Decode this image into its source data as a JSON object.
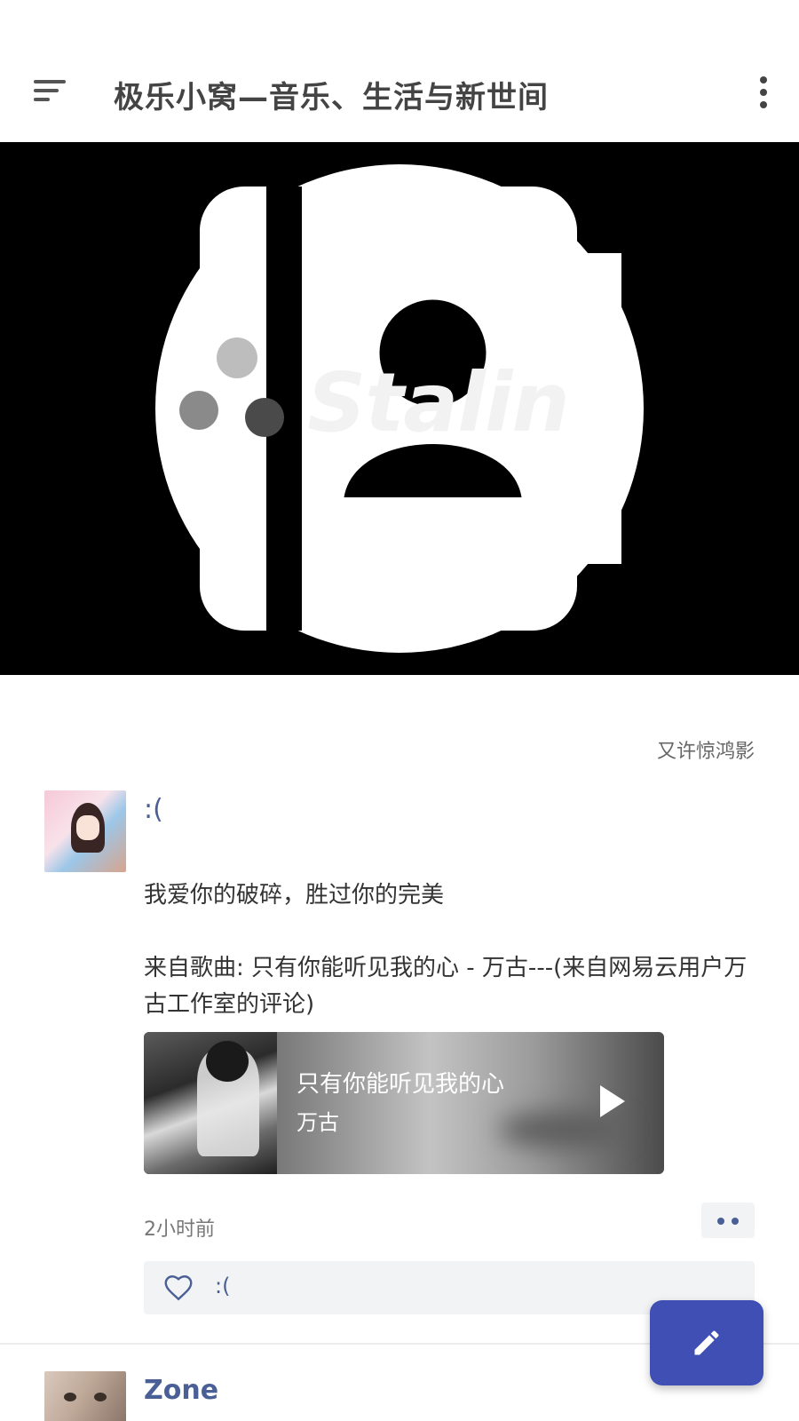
{
  "appbar": {
    "title": "极乐小窝—音乐、生活与新世间",
    "menu_icon": "sort-menu-icon",
    "more_icon": "more-vert-icon"
  },
  "hero": {
    "account_icon": "account-circle-icon",
    "contacts_icon": "contacts-book-icon",
    "logo_text": "Stalin"
  },
  "signature": "又许惊鸿影",
  "post": {
    "username": ":(",
    "text_line1": "我爱你的破碎，胜过你的完美",
    "text_line2": "来自歌曲: 只有你能听见我的心 - 万古---(来自网易云用户万古工作室的评论)",
    "music": {
      "song": "只有你能听见我的心",
      "artist": "万古"
    },
    "time": "2小时前",
    "likes": {
      "users": ":("
    }
  },
  "next_post": {
    "username": "Zone"
  },
  "fab": {
    "icon": "edit-pencil-icon"
  },
  "colors": {
    "accent": "#3f4fb4",
    "link": "#4a5f95",
    "panel": "#f2f3f5"
  }
}
